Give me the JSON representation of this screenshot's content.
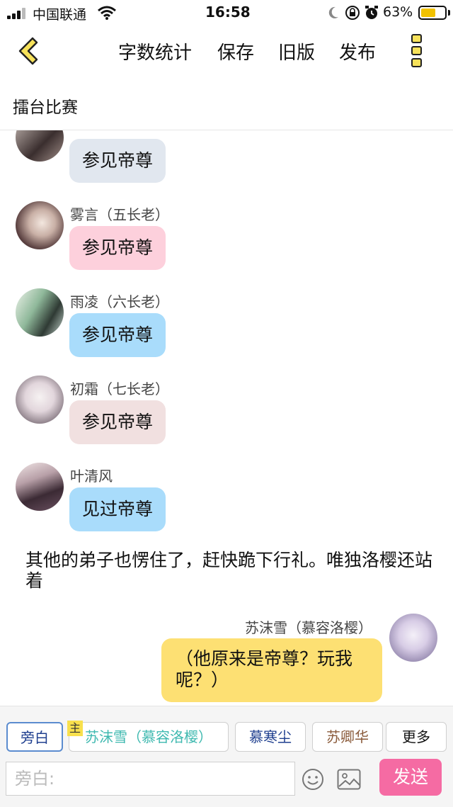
{
  "status_bar": {
    "carrier": "中国联通",
    "time": "16:58",
    "battery": "63%",
    "battery_level": 0.63
  },
  "toolbar": {
    "word_count_label": "字数统计",
    "save_label": "保存",
    "old_version_label": "旧版",
    "publish_label": "发布"
  },
  "doc": {
    "title": "擂台比赛"
  },
  "messages": [
    {
      "sender": "",
      "text": "参见帝尊",
      "bubble_color": "#e1e7ef"
    },
    {
      "sender": "雾言（五长老）",
      "text": "参见帝尊",
      "bubble_color": "#fdd0dc"
    },
    {
      "sender": "雨凌（六长老）",
      "text": "参见帝尊",
      "bubble_color": "#a9dcfb"
    },
    {
      "sender": "初霜（七长老）",
      "text": "参见帝尊",
      "bubble_color": "#f1e0e0"
    },
    {
      "sender": "叶清风",
      "text": "见过帝尊",
      "bubble_color": "#a9dcfb"
    }
  ],
  "narration": "其他的弟子也愣住了，赶快跪下行礼。唯独洛樱还站着",
  "my_message": {
    "sender": "苏沫雪（慕容洛樱）",
    "text": "（他原来是帝尊？玩我呢？）",
    "bubble_color": "#fde073"
  },
  "roles": {
    "narrator": "旁白",
    "main_badge": "主",
    "role_1": "苏沫雪（慕容洛樱）",
    "role_2": "慕寒尘",
    "role_3": "苏卿华",
    "more": "更多"
  },
  "input": {
    "placeholder": "旁白:"
  },
  "send_label": "发送",
  "colors": {
    "accent_pink": "#f56ba3",
    "role_1_text": "#3fb9b0",
    "role_2_text": "#1f3f8f",
    "role_3_text": "#8a5a3a",
    "narrator_text": "#1f3f8f",
    "back_icon_fill": "#f7e25a"
  }
}
